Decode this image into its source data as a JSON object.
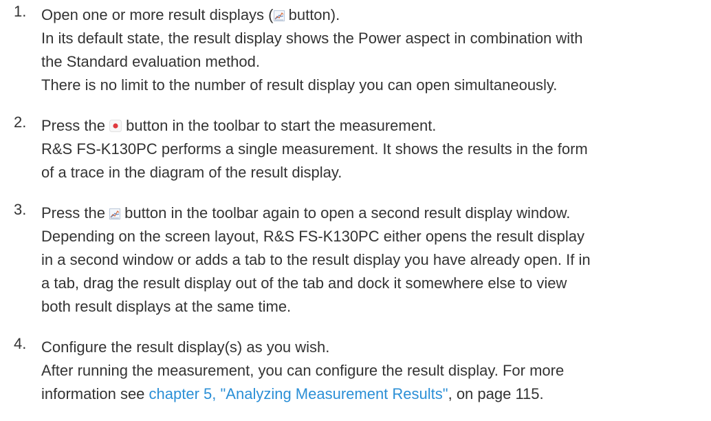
{
  "steps": [
    {
      "number": "1.",
      "text_a": "Open one or more result displays (",
      "icon_a": "chart-icon",
      "text_b": " button).",
      "lines": [
        "In its default state, the result display shows the Power aspect in combination with",
        "the Standard evaluation method.",
        "There is no limit to the number of result display you can open simultaneously."
      ]
    },
    {
      "number": "2.",
      "text_a": "Press the ",
      "icon_a": "record-icon",
      "text_b": " button in the toolbar to start the measurement.",
      "lines": [
        "R&S FS-K130PC performs a single measurement. It shows the results in the form",
        "of a trace in the diagram of the result display."
      ]
    },
    {
      "number": "3.",
      "text_a": "Press the ",
      "icon_a": "chart-icon",
      "text_b": " button in the toolbar again to open a second result display window.",
      "lines": [
        "Depending on the screen layout, R&S FS-K130PC either opens the result display",
        "in a second window or adds a tab to the result display you have already open. If in",
        "a tab, drag the result display out of the tab and dock it somewhere else to view",
        "both result displays at the same time."
      ]
    },
    {
      "number": "4.",
      "text_a": "Configure the result display(s) as you wish.",
      "lines": [
        "After running the measurement, you can configure the result display. For more"
      ],
      "last_line_pre": "information see ",
      "link_text": "chapter 5, \"Analyzing Measurement Results\"",
      "last_line_post": ", on page 115."
    }
  ],
  "colors": {
    "text": "#333333",
    "link": "#2b8fd6",
    "record": "#e0393e"
  }
}
